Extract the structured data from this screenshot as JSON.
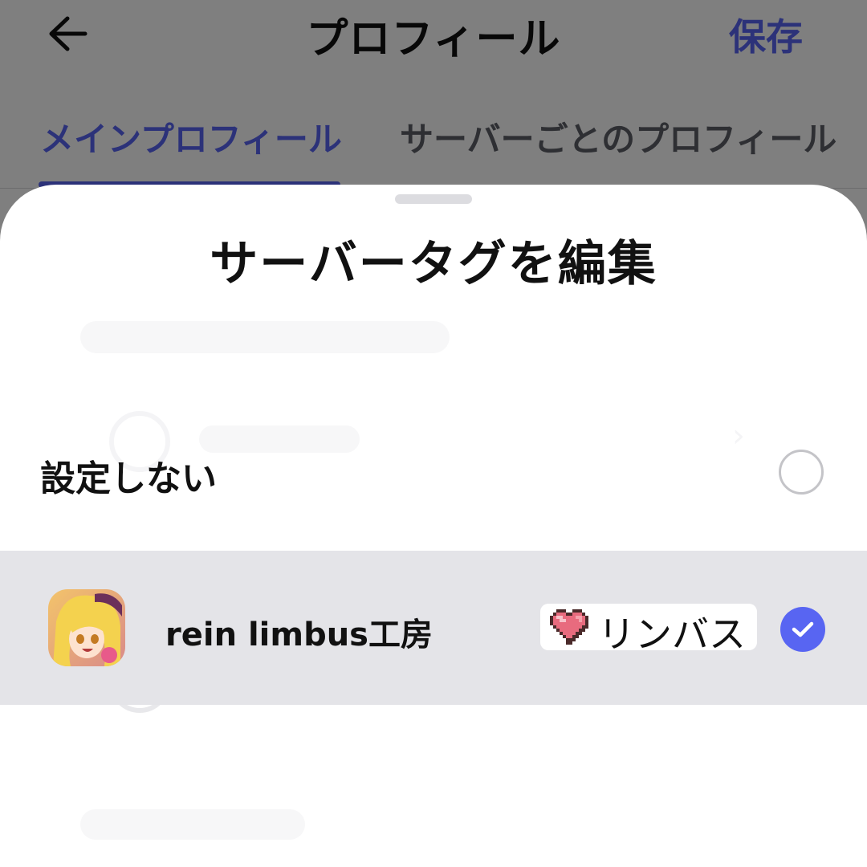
{
  "header": {
    "back_icon": "arrow-left-icon",
    "title": "プロフィール",
    "save_label": "保存"
  },
  "tabs": [
    {
      "label": "メインプロフィール",
      "active": true
    },
    {
      "label": "サーバーごとのプロフィール",
      "active": false
    }
  ],
  "sheet": {
    "title": "サーバータグを編集",
    "options": {
      "none": {
        "label": "設定しない",
        "selected": false
      },
      "server": {
        "name": "rein limbus工房",
        "tag": {
          "icon": "pixel-heart-icon",
          "text": "リンバス"
        },
        "selected": true
      }
    }
  },
  "colors": {
    "accent": "#5865f2",
    "selected_row": "#e4e4e8",
    "tag_bg": "#ffffff"
  }
}
